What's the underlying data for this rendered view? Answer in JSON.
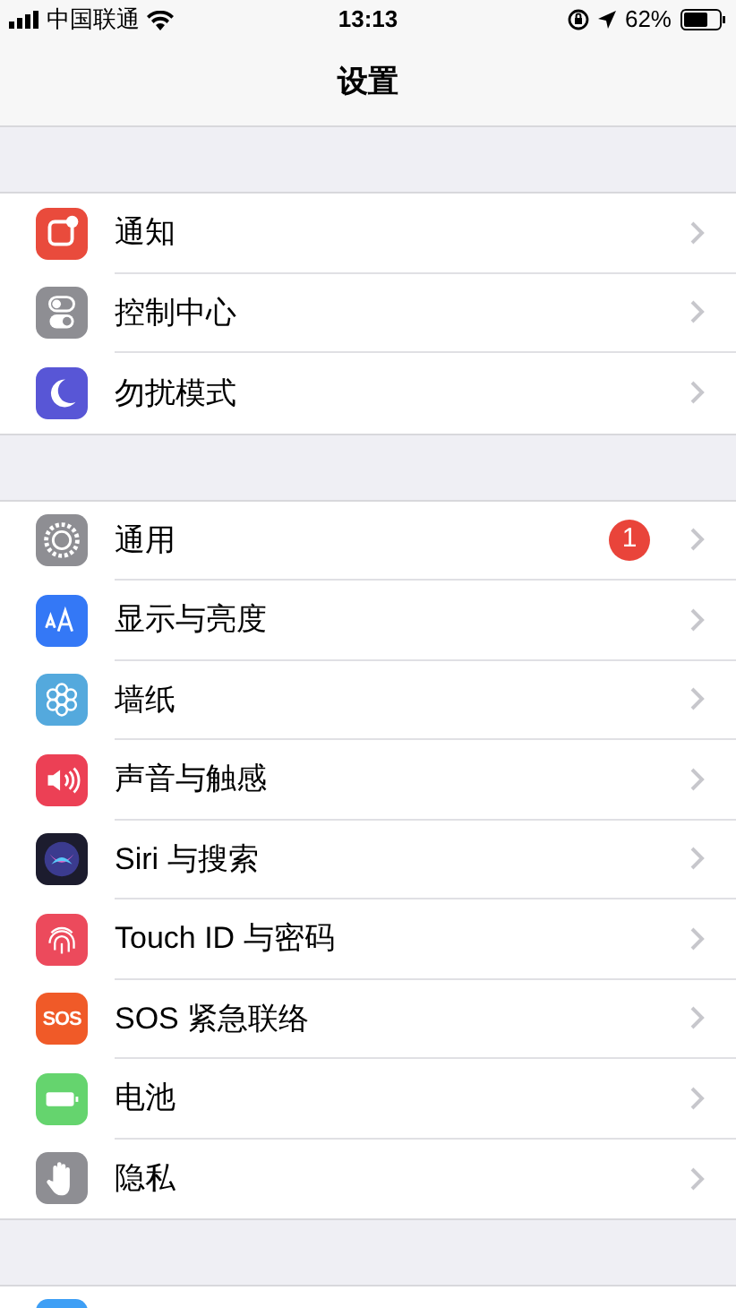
{
  "status_bar": {
    "carrier": "中国联通",
    "time": "13:13",
    "battery": "62%"
  },
  "title": "设置",
  "groups": [
    {
      "items": [
        {
          "label": "通知"
        },
        {
          "label": "控制中心"
        },
        {
          "label": "勿扰模式"
        }
      ]
    },
    {
      "items": [
        {
          "label": "通用",
          "badge": "1"
        },
        {
          "label": "显示与亮度"
        },
        {
          "label": "墙纸"
        },
        {
          "label": "声音与触感"
        },
        {
          "label": "Siri 与搜索"
        },
        {
          "label": "Touch ID 与密码"
        },
        {
          "label": "SOS 紧急联络",
          "icon_text": "SOS"
        },
        {
          "label": "电池"
        },
        {
          "label": "隐私"
        }
      ]
    }
  ]
}
